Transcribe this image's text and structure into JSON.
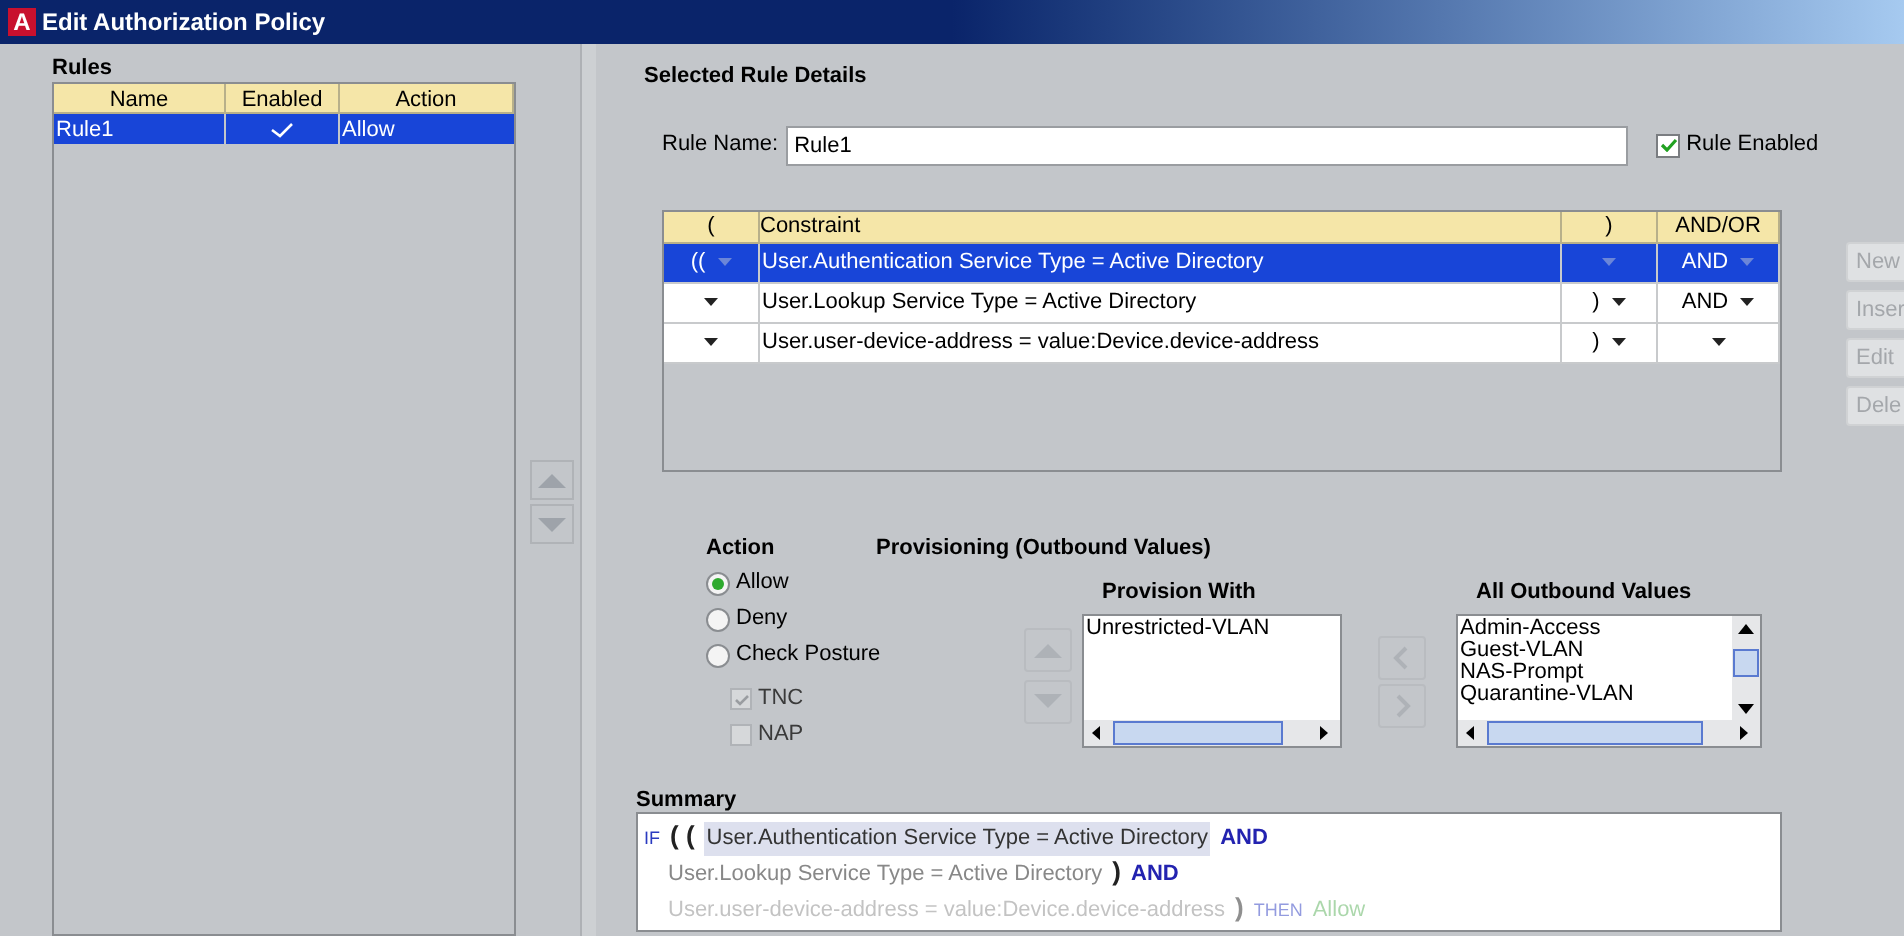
{
  "window": {
    "title": "Edit Authorization Policy",
    "icon_letter": "A"
  },
  "rules": {
    "label": "Rules",
    "columns": [
      "Name",
      "Enabled",
      "Action"
    ],
    "rows": [
      {
        "name": "Rule1",
        "enabled": true,
        "action": "Allow",
        "selected": true
      }
    ]
  },
  "details": {
    "title": "Selected Rule Details",
    "rule_name_label": "Rule Name:",
    "rule_name": "Rule1",
    "rule_enabled_label": "Rule Enabled",
    "rule_enabled": true
  },
  "constraints": {
    "columns": [
      "(",
      "Constraint",
      ")",
      "AND/OR"
    ],
    "rows": [
      {
        "open": "((",
        "constraint": "User.Authentication Service Type  =  Active Directory",
        "close": "",
        "andor": "AND",
        "selected": true
      },
      {
        "open": "",
        "constraint": "User.Lookup Service Type  =  Active Directory",
        "close": ")",
        "andor": "AND",
        "selected": false
      },
      {
        "open": "",
        "constraint": "User.user-device-address  =  value:Device.device-address",
        "close": ")",
        "andor": "",
        "selected": false
      }
    ]
  },
  "side_buttons": [
    {
      "label": "New",
      "disabled": true
    },
    {
      "label": "Inser",
      "disabled": true
    },
    {
      "label": "Edit",
      "disabled": true
    },
    {
      "label": "Dele",
      "disabled": true
    }
  ],
  "action": {
    "title": "Action",
    "options": [
      {
        "label": "Allow",
        "selected": true
      },
      {
        "label": "Deny",
        "selected": false
      },
      {
        "label": "Check Posture",
        "selected": false
      }
    ],
    "posture_checks": [
      {
        "label": "TNC",
        "checked": true,
        "disabled": true
      },
      {
        "label": "NAP",
        "checked": false,
        "disabled": true
      }
    ]
  },
  "provisioning": {
    "title": "Provisioning (Outbound Values)",
    "provision_with_label": "Provision With",
    "provision_with": [
      "Unrestricted-VLAN"
    ],
    "all_outbound_label": "All Outbound Values",
    "all_outbound": [
      "Admin-Access",
      "Guest-VLAN",
      "NAS-Prompt",
      "Quarantine-VLAN"
    ]
  },
  "summary": {
    "label": "Summary",
    "lines": [
      [
        {
          "kind": "keyword",
          "text": "IF"
        },
        {
          "kind": "paren",
          "text": "( ("
        },
        {
          "kind": "highlight",
          "text": "User.Authentication Service Type  =  Active Directory"
        },
        {
          "kind": "operator",
          "text": "AND"
        }
      ],
      [
        {
          "kind": "text",
          "text": "User.Lookup Service Type  =  Active Directory"
        },
        {
          "kind": "paren",
          "text": ")"
        },
        {
          "kind": "operator",
          "text": "AND"
        }
      ],
      [
        {
          "kind": "text",
          "text": "User.user-device-address  =  value:Device.device-address"
        },
        {
          "kind": "paren",
          "text": ")"
        },
        {
          "kind": "keyword",
          "text": "THEN"
        },
        {
          "kind": "result",
          "text": "Allow"
        }
      ]
    ]
  }
}
